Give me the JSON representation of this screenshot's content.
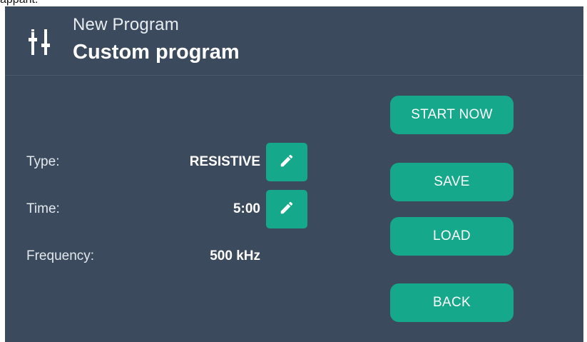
{
  "top_fragment": "appant.",
  "header": {
    "icon": "sliders-icon",
    "subtitle": "New Program",
    "title": "Custom program"
  },
  "settings": [
    {
      "label": "Type:",
      "value": "RESISTIVE",
      "editable": true
    },
    {
      "label": "Time:",
      "value": "5:00",
      "editable": true
    },
    {
      "label": "Frequency:",
      "value": "500 kHz",
      "editable": false
    }
  ],
  "actions": {
    "start_now": "START NOW",
    "save": "SAVE",
    "load": "LOAD",
    "back": "BACK"
  },
  "colors": {
    "panel_bg": "#3b4a5c",
    "accent": "#16a88a",
    "text": "#ffffff"
  },
  "icons": {
    "edit": "pencil-icon"
  }
}
